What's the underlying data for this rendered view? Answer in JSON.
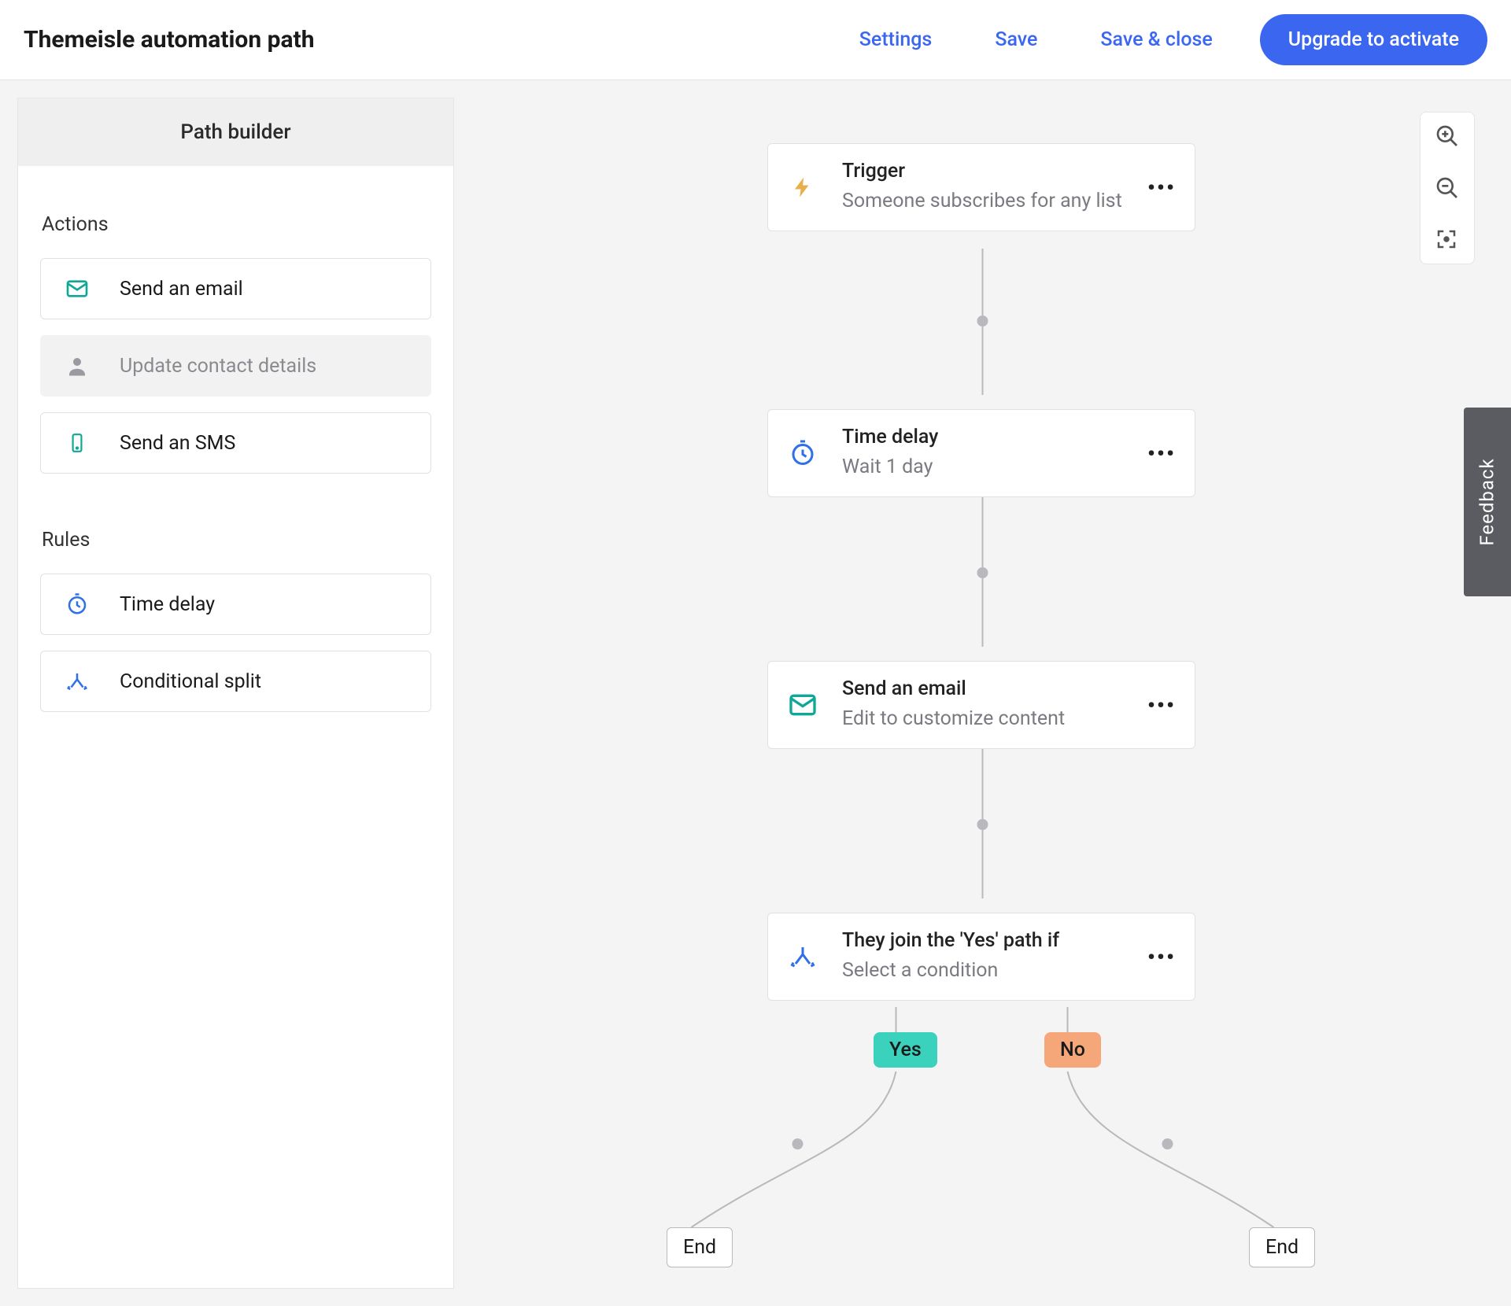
{
  "header": {
    "title": "Themeisle automation path",
    "settings": "Settings",
    "save": "Save",
    "save_close": "Save & close",
    "upgrade": "Upgrade to activate"
  },
  "sidebar": {
    "title": "Path builder",
    "actions_heading": "Actions",
    "rules_heading": "Rules",
    "actions": {
      "email": "Send an email",
      "update_contact": "Update contact details",
      "sms": "Send an SMS"
    },
    "rules": {
      "delay": "Time delay",
      "split": "Conditional split"
    }
  },
  "canvas": {
    "trigger": {
      "title": "Trigger",
      "sub": "Someone subscribes for any list"
    },
    "delay": {
      "title": "Time delay",
      "sub": "Wait 1 day"
    },
    "email": {
      "title": "Send an email",
      "sub": "Edit to customize content"
    },
    "split": {
      "title": "They join the 'Yes' path if",
      "sub": "Select a condition"
    },
    "yes": "Yes",
    "no": "No",
    "end": "End"
  },
  "feedback": "Feedback",
  "colors": {
    "accent": "#3a66f0",
    "teal": "#0fa796",
    "blue": "#2f6fe8",
    "gold": "#e8b04b",
    "yes": "#3ad1bd",
    "no": "#f5a77a"
  }
}
